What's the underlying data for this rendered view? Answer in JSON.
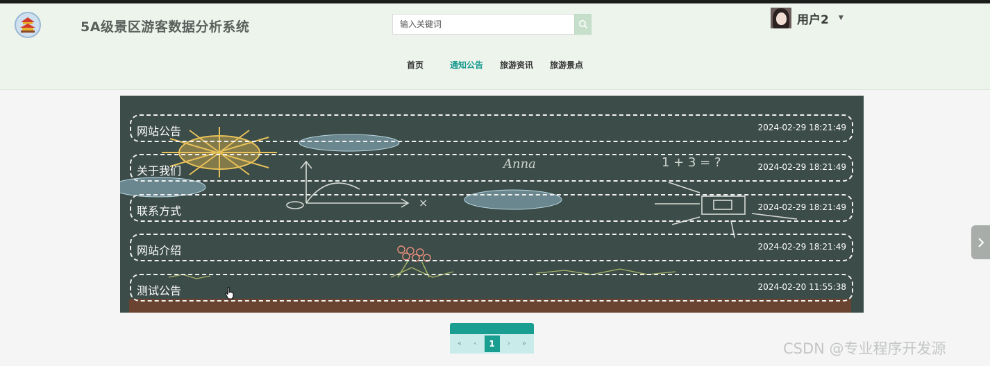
{
  "header": {
    "site_title": "5A级景区游客数据分析系统",
    "logo_icon": "temple-icon"
  },
  "search": {
    "placeholder": "输入关键词",
    "button_icon": "search-icon"
  },
  "user": {
    "name": "用户2",
    "caret_icon": "caret-down-icon"
  },
  "nav": {
    "items": [
      {
        "label": "首页"
      },
      {
        "label": "通知公告",
        "active": true
      },
      {
        "label": "旅游资讯"
      },
      {
        "label": "旅游景点"
      }
    ]
  },
  "notices": [
    {
      "title": "网站公告",
      "date": "2024-02-29 18:21:49"
    },
    {
      "title": "关于我们",
      "date": "2024-02-29 18:21:49"
    },
    {
      "title": "联系方式",
      "date": "2024-02-29 18:21:49"
    },
    {
      "title": "网站介绍",
      "date": "2024-02-29 18:21:49"
    },
    {
      "title": "测试公告",
      "date": "2024-02-20 11:55:38"
    }
  ],
  "board_doodle_text": {
    "name": "Anna",
    "math": "1 + 3 = ?"
  },
  "pagination": {
    "first": "«",
    "prev": "‹",
    "current": "1",
    "next": "›",
    "last": "»"
  },
  "watermark": "CSDN @专业程序开发源",
  "colors": {
    "accent": "#189a8f",
    "header_bg": "#edf4ec",
    "board_bg": "#3c4c48"
  }
}
